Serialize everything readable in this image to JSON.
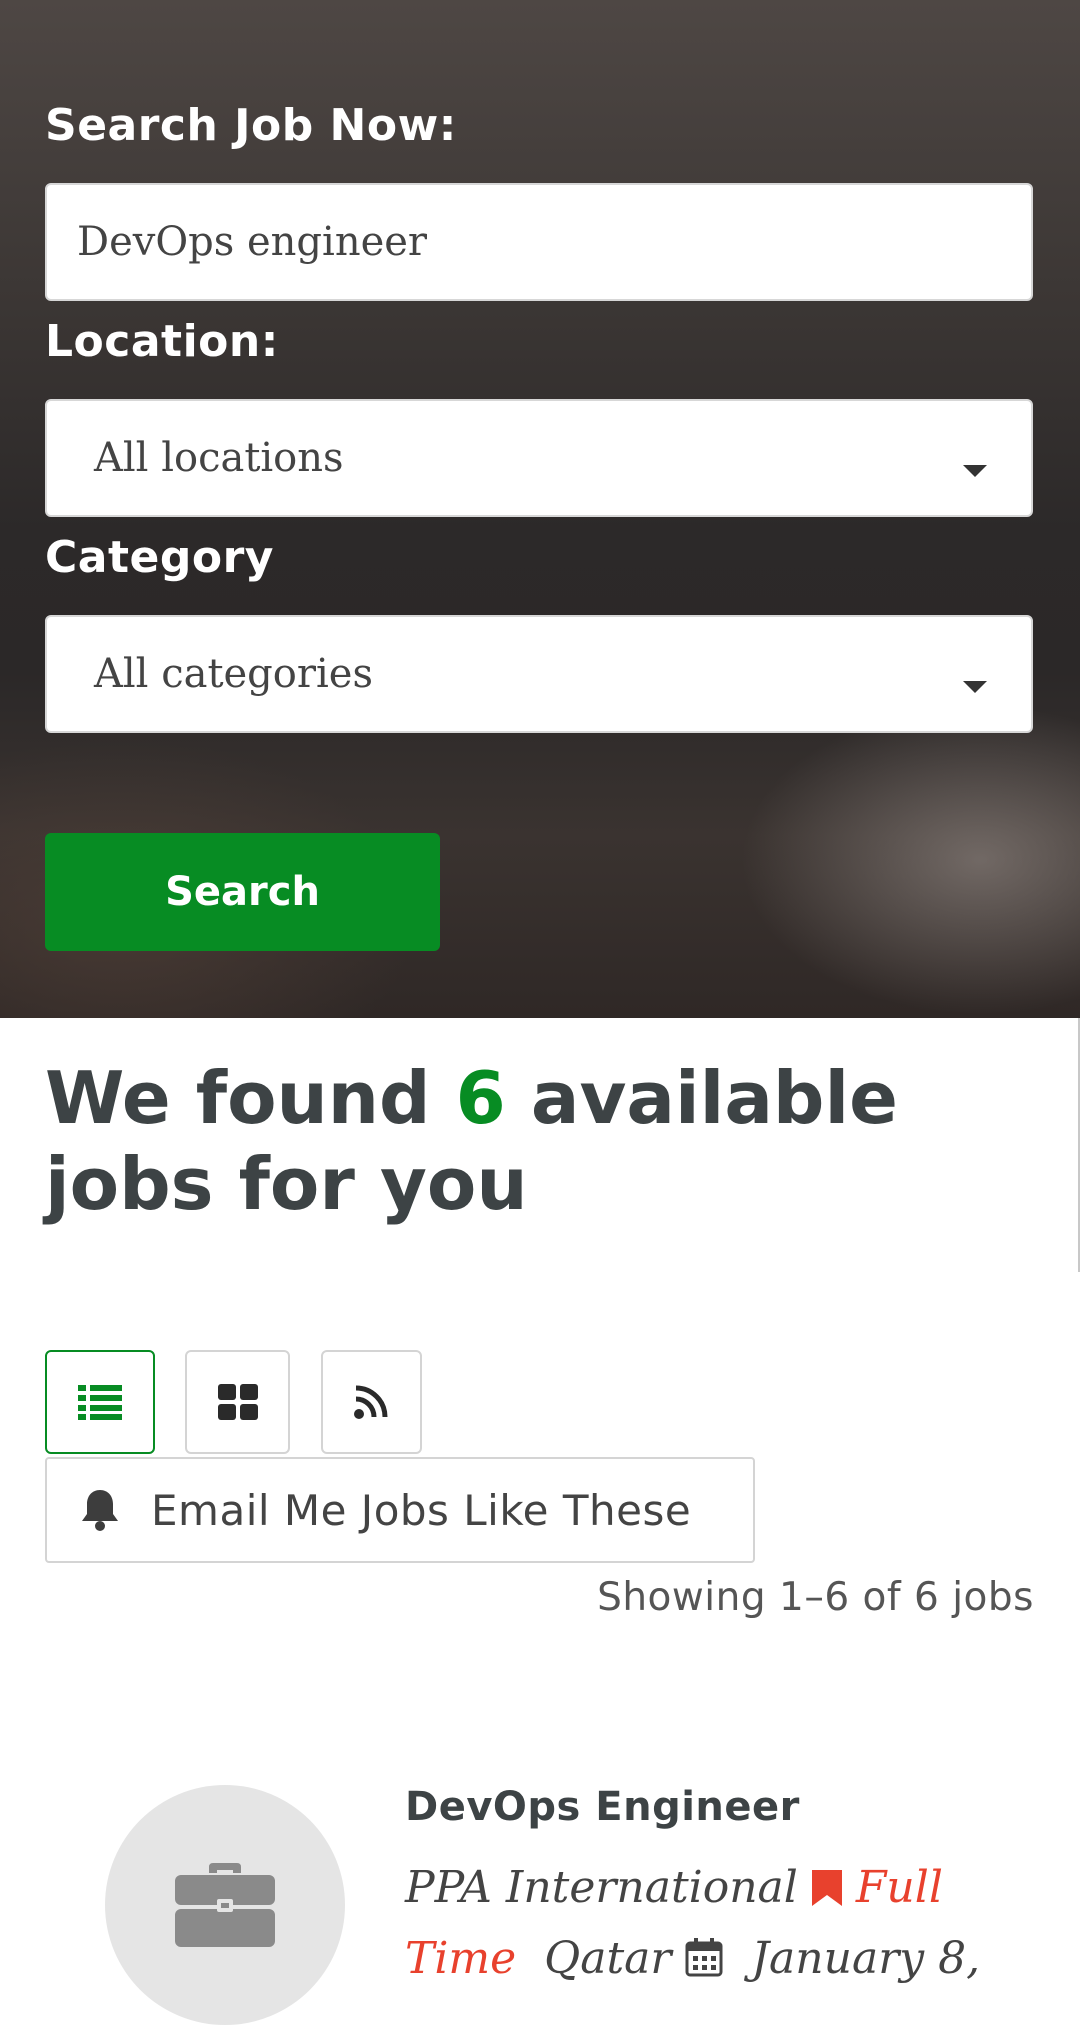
{
  "search": {
    "job_label": "Search Job Now:",
    "keyword_value": "DevOps engineer",
    "location_label": "Location:",
    "location_value": "All locations",
    "category_label": "Category",
    "category_value": "All categories",
    "button_label": "Search"
  },
  "results": {
    "headline_before": "We found",
    "count": "6",
    "headline_after": "available jobs for you",
    "alert_label": "Email Me Jobs Like These",
    "showing": "Showing 1–6 of 6 jobs"
  },
  "view_toggle": {
    "items": [
      {
        "icon": "list-icon",
        "active": true
      },
      {
        "icon": "grid-icon",
        "active": false
      },
      {
        "icon": "rss-icon",
        "active": false
      }
    ]
  },
  "job": {
    "title": "DevOps Engineer",
    "company": "PPA International",
    "type": "Full Time",
    "location": "Qatar",
    "date": "January 8,"
  },
  "colors": {
    "accent": "#078c23",
    "job_type": "#e8412d",
    "heading": "#3d4345"
  }
}
